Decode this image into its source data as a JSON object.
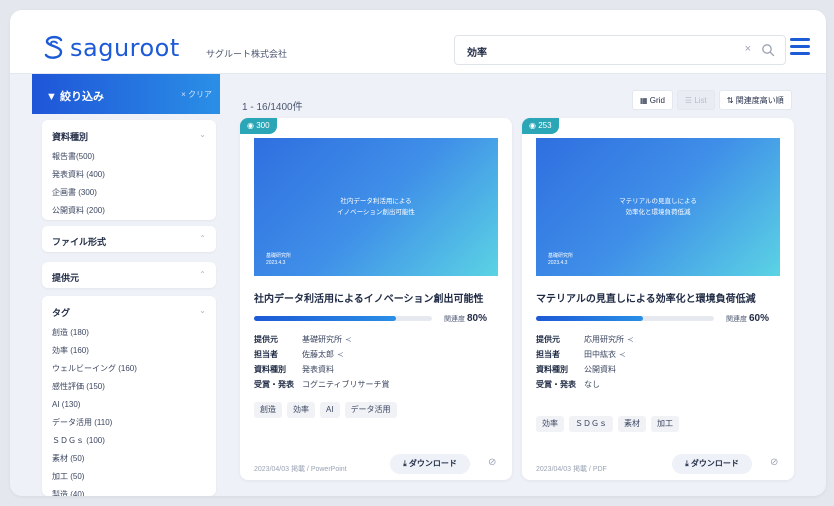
{
  "header": {
    "brand": "saguroot",
    "company": "サグルート株式会社",
    "search_value": "効率",
    "clear_label": "×"
  },
  "sidebar": {
    "filter_title": "絞り込み",
    "clear_label": "× クリア",
    "sections": {
      "doc_type": {
        "title": "資料種別",
        "items": [
          "報告書(500)",
          "発表資料 (400)",
          "企画書 (300)",
          "公開資料 (200)"
        ]
      },
      "file_format": {
        "title": "ファイル形式"
      },
      "provider": {
        "title": "提供元"
      },
      "tags": {
        "title": "タグ",
        "items": [
          "創造 (180)",
          "効率 (160)",
          "ウェルビーイング (160)",
          "感性評価 (150)",
          "AI (130)",
          "データ活用 (110)",
          "ＳＤＧｓ (100)",
          "素材 (50)",
          "加工 (50)",
          "製造 (40)"
        ]
      }
    }
  },
  "results": {
    "count_label": "1 - 16/1400件",
    "grid_label": "Grid",
    "list_label": "List",
    "sort_label": "関連度高い順"
  },
  "cards": [
    {
      "views": "300",
      "thumb_title_1": "社内データ利活用による",
      "thumb_title_2": "イノベーション創出可能性",
      "thumb_org": "基礎研究所",
      "thumb_date": "2023.4.3",
      "title": "社内データ利活用によるイノベーション創出可能性",
      "relevance_label": "関連度",
      "relevance": "80%",
      "relevance_value": 0.8,
      "meta": [
        {
          "k": "提供元",
          "v": "基礎研究所"
        },
        {
          "k": "担当者",
          "v": "佐藤太郎"
        },
        {
          "k": "資料種別",
          "v": "発表資料"
        },
        {
          "k": "受賞・発表",
          "v": "コグニティブリサーチ賞"
        }
      ],
      "tags": [
        "創造",
        "効率",
        "AI",
        "データ活用"
      ],
      "footer": "2023/04/03 掲載 / PowerPoint",
      "download": "ダウンロード"
    },
    {
      "views": "253",
      "thumb_title_1": "マテリアルの見直しによる",
      "thumb_title_2": "効率化と環境負荷低減",
      "thumb_org": "基礎研究所",
      "thumb_date": "2023.4.3",
      "title": "マテリアルの見直しによる効率化と環境負荷低減",
      "relevance_label": "関連度",
      "relevance": "60%",
      "relevance_value": 0.6,
      "meta": [
        {
          "k": "提供元",
          "v": "応用研究所"
        },
        {
          "k": "担当者",
          "v": "田中紘衣"
        },
        {
          "k": "資料種別",
          "v": "公開資料"
        },
        {
          "k": "受賞・発表",
          "v": "なし"
        }
      ],
      "tags": [
        "効率",
        "ＳＤＧｓ",
        "素材",
        "加工"
      ],
      "footer": "2023/04/03 掲載 / PDF",
      "download": "ダウンロード"
    }
  ]
}
